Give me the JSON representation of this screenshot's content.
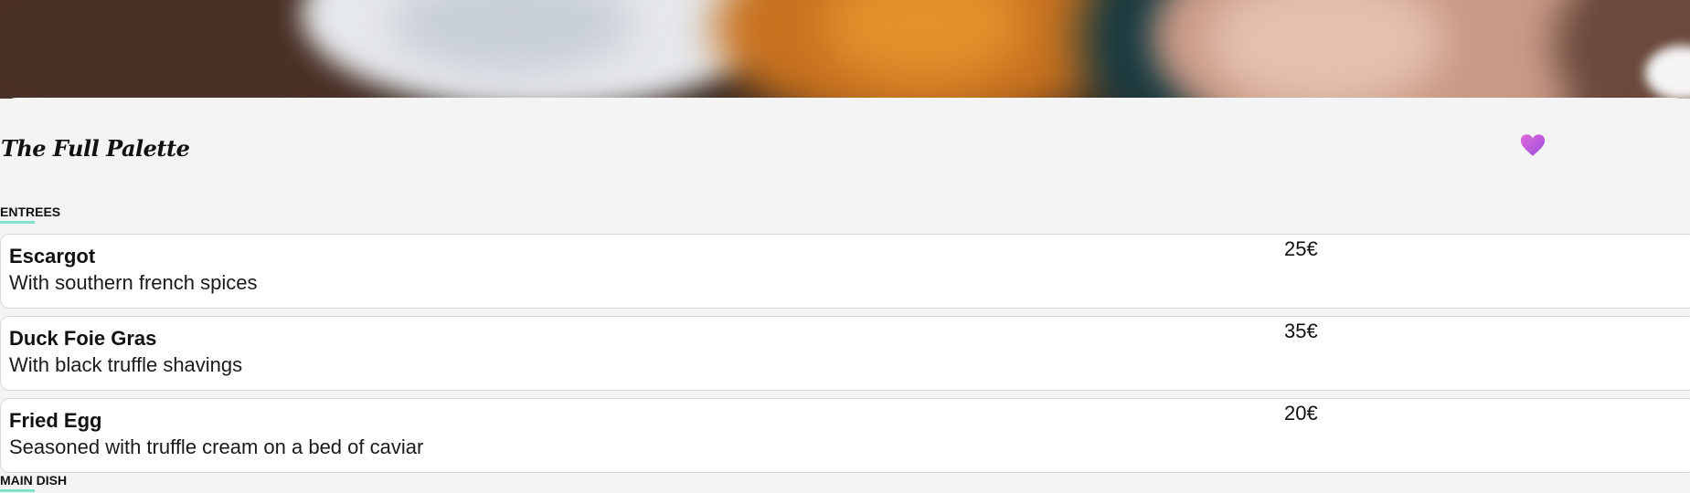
{
  "restaurant": {
    "name": "The Full Palette"
  },
  "favorite": {
    "icon": "heart-icon",
    "color": "#c65be0"
  },
  "accent_color": "#7fe3c9",
  "sections": [
    {
      "title": "ENTREES",
      "items": [
        {
          "name": "Escargot",
          "description": "With southern french spices",
          "price": "25€"
        },
        {
          "name": "Duck Foie Gras",
          "description": "With black truffle shavings",
          "price": "35€"
        },
        {
          "name": "Fried Egg",
          "description": "Seasoned with truffle cream on a bed of caviar",
          "price": "20€"
        }
      ]
    },
    {
      "title": "MAIN DISH",
      "items": []
    }
  ]
}
